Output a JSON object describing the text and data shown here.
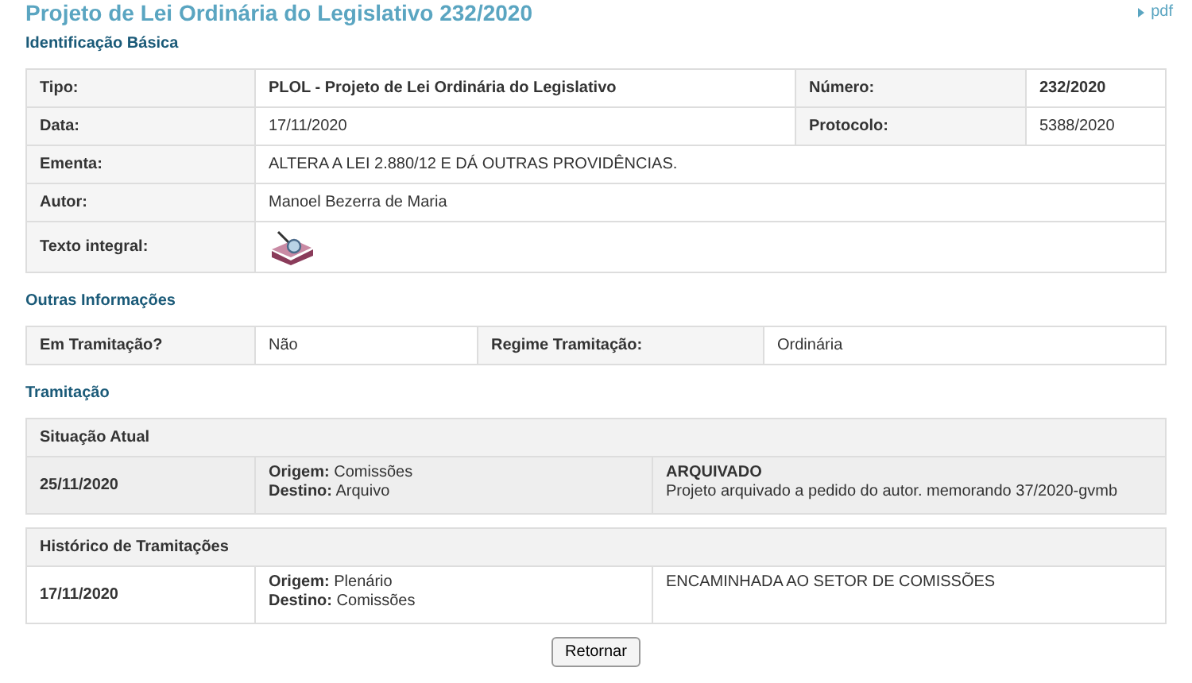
{
  "title": "Projeto de Lei Ordinária do Legislativo 232/2020",
  "pdf_link": "pdf",
  "basic": {
    "heading": "Identificação Básica",
    "rows": [
      {
        "kind": "pair",
        "cells": [
          {
            "label": "Tipo:",
            "value": "PLOL - Projeto de Lei Ordinária do Legislativo",
            "bold": true
          },
          {
            "label": "Número:",
            "value": "232/2020",
            "bold": true
          }
        ]
      },
      {
        "kind": "pair",
        "cells": [
          {
            "label": "Data:",
            "value": "17/11/2020",
            "bold": false
          },
          {
            "label": "Protocolo:",
            "value": "5388/2020",
            "bold": false
          }
        ]
      },
      {
        "kind": "single",
        "label": "Ementa:",
        "value": "ALTERA A LEI 2.880/12 E DÁ OUTRAS PROVIDÊNCIAS."
      },
      {
        "kind": "single",
        "label": "Autor:",
        "value": "Manoel Bezerra de Maria"
      },
      {
        "kind": "document",
        "label": "Texto integral:"
      }
    ]
  },
  "other": {
    "heading": "Outras Informações",
    "cells": [
      {
        "label": "Em Tramitação?",
        "value": "Não"
      },
      {
        "label": "Regime Tramitação:",
        "value": "Ordinária"
      }
    ]
  },
  "tramitacao": {
    "heading": "Tramitação",
    "tables": [
      {
        "title": "Situação Atual",
        "shaded": true,
        "date": "25/11/2020",
        "origin_label": "Origem:",
        "origin": "Comissões",
        "destination_label": "Destino:",
        "destination": "Arquivo",
        "status": "ARQUIVADO",
        "note": "Projeto arquivado a pedido do autor. memorando 37/2020-gvmb"
      },
      {
        "title": "Histórico de Tramitações",
        "shaded": false,
        "date": "17/11/2020",
        "origin_label": "Origem:",
        "origin": "Plenário",
        "destination_label": "Destino:",
        "destination": "Comissões",
        "note": "ENCAMINHADA AO SETOR DE COMISSÕES"
      }
    ]
  },
  "back_button": "Retornar"
}
